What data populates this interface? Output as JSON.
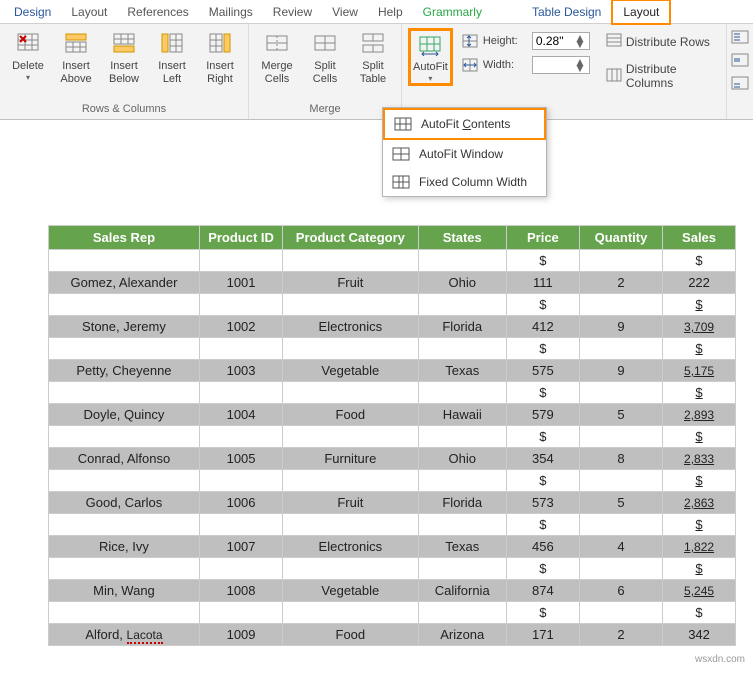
{
  "tabs": {
    "design": "Design",
    "layoutTop": "Layout",
    "references": "References",
    "mailings": "Mailings",
    "review": "Review",
    "view": "View",
    "help": "Help",
    "grammarly": "Grammarly",
    "tableDesign": "Table Design",
    "layout": "Layout"
  },
  "ribbon": {
    "delete": "Delete",
    "insertAbove": "Insert\nAbove",
    "insertBelow": "Insert\nBelow",
    "insertLeft": "Insert\nLeft",
    "insertRight": "Insert\nRight",
    "rowsCols": "Rows & Columns",
    "mergeCells": "Merge\nCells",
    "splitCells": "Split\nCells",
    "splitTable": "Split\nTable",
    "merge": "Merge",
    "autofit": "AutoFit",
    "height": "Height:",
    "heightVal": "0.28\"",
    "width": "Width:",
    "widthVal": "",
    "distributeRows": "Distribute Rows",
    "distributeCols": "Distribute Columns"
  },
  "dropdown": {
    "autofitContents": "AutoFit Contents",
    "autofitWindow": "AutoFit Window",
    "fixedWidth": "Fixed Column Width"
  },
  "table": {
    "headers": [
      "Sales Rep",
      "Product ID",
      "Product Category",
      "States",
      "Price",
      "Quantity",
      "Sales"
    ],
    "rows": [
      {
        "rep": "Gomez, Alexander",
        "id": "1001",
        "cat": "Fruit",
        "state": "Ohio",
        "price": "111",
        "qty": "2",
        "sales": "222",
        "ul": false
      },
      {
        "rep": "Stone, Jeremy",
        "id": "1002",
        "cat": "Electronics",
        "state": "Florida",
        "price": "412",
        "qty": "9",
        "sales": "3,709",
        "ul": true
      },
      {
        "rep": "Petty, Cheyenne",
        "id": "1003",
        "cat": "Vegetable",
        "state": "Texas",
        "price": "575",
        "qty": "9",
        "sales": "5,175",
        "ul": true
      },
      {
        "rep": "Doyle, Quincy",
        "id": "1004",
        "cat": "Food",
        "state": "Hawaii",
        "price": "579",
        "qty": "5",
        "sales": "2,893",
        "ul": true
      },
      {
        "rep": "Conrad, Alfonso",
        "id": "1005",
        "cat": "Furniture",
        "state": "Ohio",
        "price": "354",
        "qty": "8",
        "sales": "2,833",
        "ul": true
      },
      {
        "rep": "Good, Carlos",
        "id": "1006",
        "cat": "Fruit",
        "state": "Florida",
        "price": "573",
        "qty": "5",
        "sales": "2,863",
        "ul": true
      },
      {
        "rep": "Rice, Ivy",
        "id": "1007",
        "cat": "Electronics",
        "state": "Texas",
        "price": "456",
        "qty": "4",
        "sales": "1,822",
        "ul": true
      },
      {
        "rep": "Min, Wang",
        "id": "1008",
        "cat": "Vegetable",
        "state": "California",
        "price": "874",
        "qty": "6",
        "sales": "5,245",
        "ul": true
      },
      {
        "rep": "Alford, Lacota",
        "id": "1009",
        "cat": "Food",
        "state": "Arizona",
        "price": "171",
        "qty": "2",
        "sales": "342",
        "ul": false,
        "squiggle": true
      }
    ]
  },
  "dollar": "$",
  "watermark": "wsxdn.com"
}
